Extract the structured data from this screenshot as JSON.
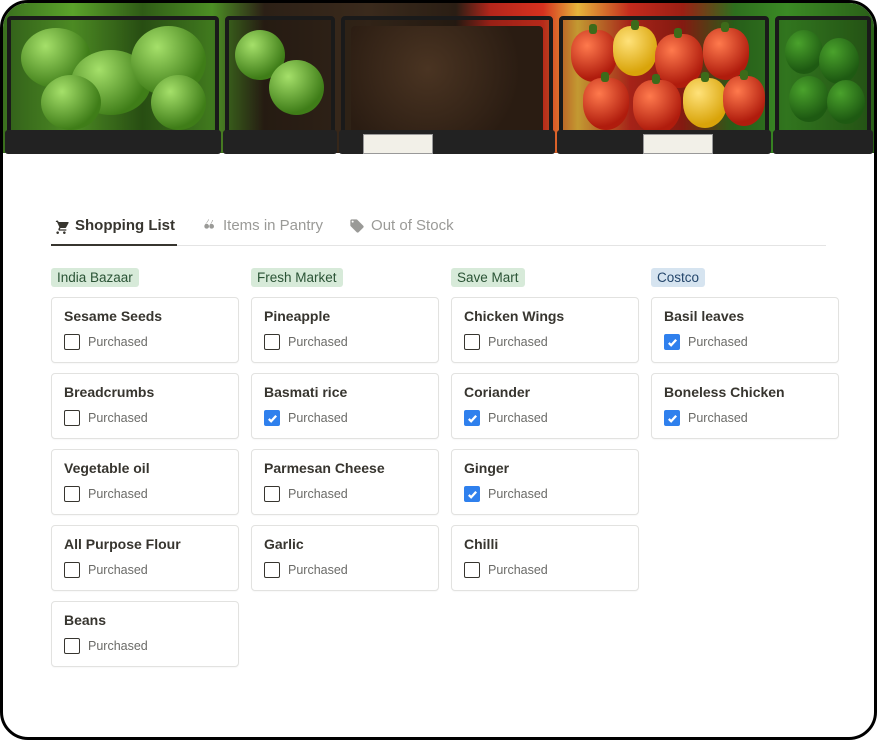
{
  "tabs": [
    {
      "label": "Shopping List",
      "icon": "cart-icon",
      "active": true
    },
    {
      "label": "Items in Pantry",
      "icon": "cherry-icon",
      "active": false
    },
    {
      "label": "Out of Stock",
      "icon": "tag-icon",
      "active": false
    }
  ],
  "checkbox_label": "Purchased",
  "columns": [
    {
      "name": "India Bazaar",
      "color": "green",
      "items": [
        {
          "title": "Sesame Seeds",
          "purchased": false
        },
        {
          "title": "Breadcrumbs",
          "purchased": false
        },
        {
          "title": "Vegetable oil",
          "purchased": false
        },
        {
          "title": "All Purpose Flour",
          "purchased": false
        },
        {
          "title": "Beans",
          "purchased": false
        }
      ]
    },
    {
      "name": "Fresh Market",
      "color": "green",
      "items": [
        {
          "title": "Pineapple",
          "purchased": false
        },
        {
          "title": "Basmati rice",
          "purchased": true
        },
        {
          "title": "Parmesan Cheese",
          "purchased": false
        },
        {
          "title": "Garlic",
          "purchased": false
        }
      ]
    },
    {
      "name": "Save Mart",
      "color": "green",
      "items": [
        {
          "title": "Chicken Wings",
          "purchased": false
        },
        {
          "title": "Coriander",
          "purchased": true
        },
        {
          "title": "Ginger",
          "purchased": true
        },
        {
          "title": "Chilli",
          "purchased": false
        }
      ]
    },
    {
      "name": "Costco",
      "color": "blue",
      "items": [
        {
          "title": "Basil leaves",
          "purchased": true
        },
        {
          "title": "Boneless Chicken",
          "purchased": true
        }
      ]
    }
  ]
}
